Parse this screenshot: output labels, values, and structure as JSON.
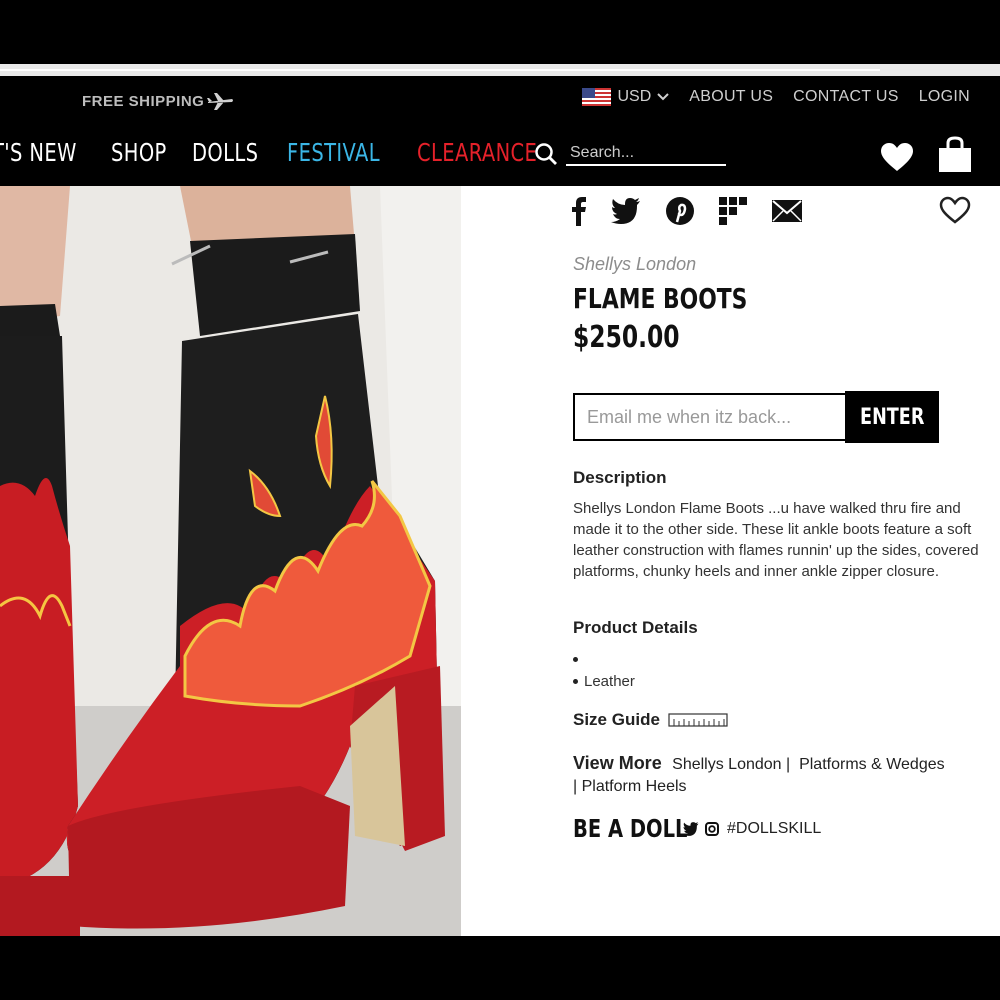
{
  "header": {
    "free_shipping": "FREE SHIPPING",
    "currency": "USD",
    "links": [
      "ABOUT US",
      "CONTACT US",
      "LOGIN"
    ]
  },
  "nav": {
    "items": [
      "T'S NEW",
      "SHOP",
      "DOLLS",
      "FESTIVAL",
      "CLEARANCE"
    ],
    "search_placeholder": "Search...",
    "festival_color": "#3bb6e6",
    "clearance_color": "#e5212a"
  },
  "share": {
    "icons": [
      "facebook-icon",
      "twitter-icon",
      "pinterest-icon",
      "grid-icon",
      "email-icon"
    ]
  },
  "product": {
    "brand": "Shellys London",
    "title": "FLAME BOOTS",
    "price": "$250.00",
    "notify_placeholder": "Email me when itz back...",
    "notify_button": "ENTER",
    "description_heading": "Description",
    "description": "Shellys London Flame Boots ...u have walked thru fire and made it to the other side. These lit ankle boots feature a soft leather construction with flames runnin' up the sides, covered platforms, chunky heels and inner ankle zipper closure.",
    "details_heading": "Product Details",
    "details": [
      "",
      "Leather"
    ],
    "size_guide": "Size Guide",
    "view_more_label": "View More",
    "view_more_links": [
      "Shellys London",
      "Platforms & Wedges",
      "Platform Heels"
    ],
    "slogan": "BE A DOLL",
    "hashtag": "#DOLLSKILL"
  }
}
